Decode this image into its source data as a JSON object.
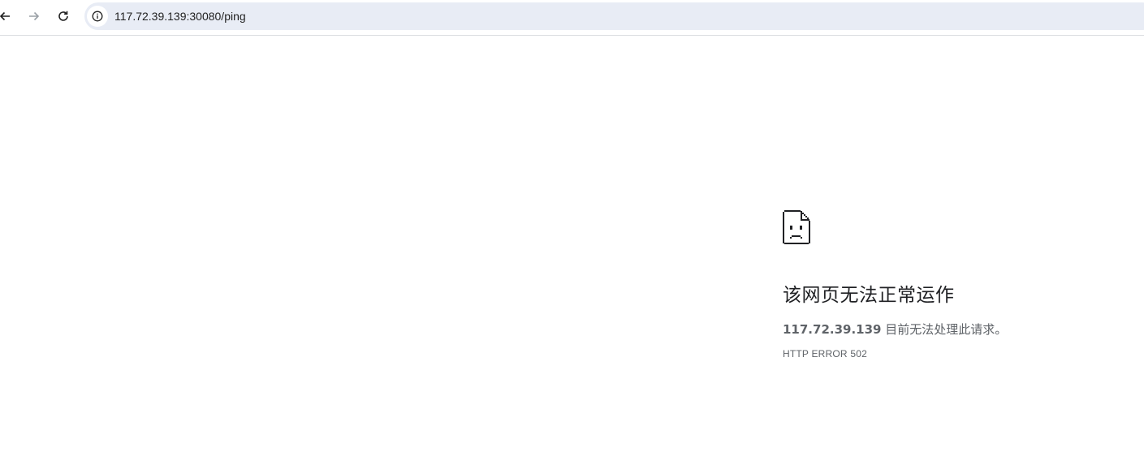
{
  "browser": {
    "back_icon": "arrow-left-icon",
    "forward_icon": "arrow-right-icon",
    "reload_icon": "reload-icon",
    "site_info_icon": "info-icon",
    "url": "117.72.39.139:30080/ping"
  },
  "error_page": {
    "icon": "sad-page-icon",
    "title": "该网页无法正常运作",
    "host": "117.72.39.139",
    "message": " 目前无法处理此请求。",
    "code": "HTTP ERROR 502"
  }
}
